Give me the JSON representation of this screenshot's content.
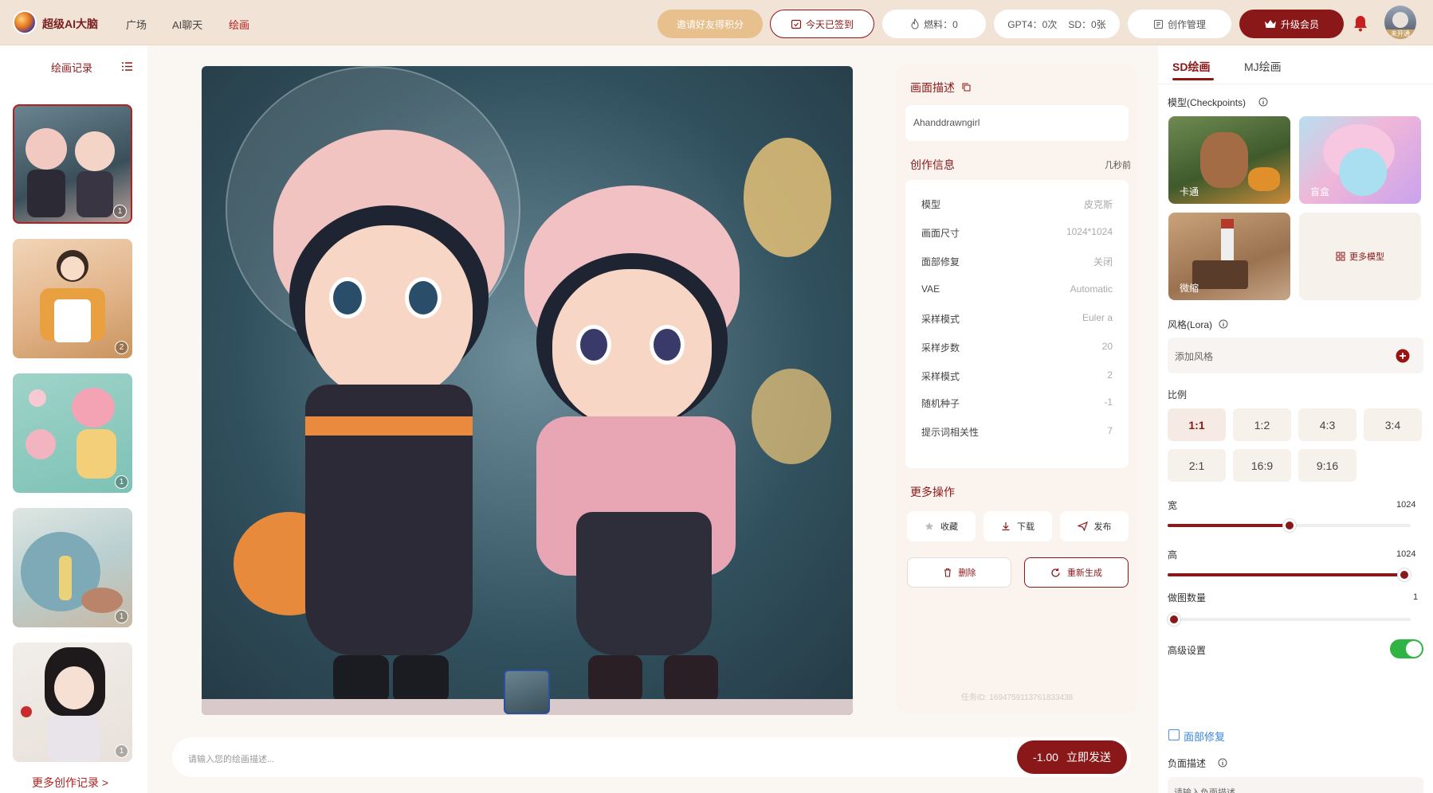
{
  "header": {
    "app_name": "超级AI大脑",
    "nav": [
      "广场",
      "AI聊天",
      "绘画"
    ],
    "invite_label": "邀请好友得积分",
    "signin_label": "今天已签到",
    "fuel_label": "燃料：0",
    "quota_gpt4": "GPT4：0次",
    "quota_sd": "SD：0张",
    "manage_label": "创作管理",
    "upgrade_label": "升级会员",
    "avatar_badge": "未开通"
  },
  "left": {
    "title": "绘画记录",
    "thumbs": [
      "1",
      "2",
      "1",
      "1",
      "1"
    ],
    "more_label": "更多创作记录 >"
  },
  "prompt": {
    "placeholder": "请输入您的绘画描述...",
    "cost": "-1.00",
    "send_label": "立即发送"
  },
  "info": {
    "desc_title": "画面描述",
    "desc_value": "Ahanddrawngirl",
    "creation_title": "创作信息",
    "creation_time": "几秒前",
    "rows": [
      {
        "k": "模型",
        "v": "皮克斯"
      },
      {
        "k": "画面尺寸",
        "v": "1024*1024"
      },
      {
        "k": "面部修复",
        "v": "关闭"
      },
      {
        "k": "VAE",
        "v": "Automatic"
      },
      {
        "k": "采样模式",
        "v": "Euler a"
      },
      {
        "k": "采样步数",
        "v": "20"
      },
      {
        "k": "采样模式",
        "v": "2"
      },
      {
        "k": "随机种子",
        "v": "-1"
      },
      {
        "k": "提示词相关性",
        "v": "7"
      }
    ],
    "more_ops_title": "更多操作",
    "ops": {
      "collect": "收藏",
      "download": "下载",
      "publish": "发布",
      "delete": "删除",
      "regenerate": "重新生成"
    },
    "task_id": "任务ID: 1694759113761833438"
  },
  "right": {
    "tabs": [
      "SD绘画",
      "MJ绘画"
    ],
    "model_title": "模型(Checkpoints)",
    "models": [
      "卡通",
      "盲盒",
      "微缩"
    ],
    "more_models": "更多模型",
    "lora_title": "风格(Lora)",
    "lora_placeholder": "添加风格",
    "ratio_title": "比例",
    "ratios": [
      "1:1",
      "1:2",
      "4:3",
      "3:4",
      "2:1",
      "16:9",
      "9:16"
    ],
    "width_label": "宽",
    "width_value": "1024",
    "width_fraction": 0.5,
    "height_label": "高",
    "height_value": "1024",
    "height_fraction": 1.0,
    "count_label": "做图数量",
    "count_value": "1",
    "count_fraction": 0.0,
    "advanced_label": "高级设置",
    "advanced_on": true,
    "face_fix_label": "面部修复",
    "neg_title": "负面描述",
    "neg_placeholder": "请输入负面描述"
  },
  "colors": {
    "accent": "#8b1818",
    "header_bg": "#f1e3d5",
    "invite_bg": "#e8c08d",
    "toggle": "#2fb344"
  }
}
